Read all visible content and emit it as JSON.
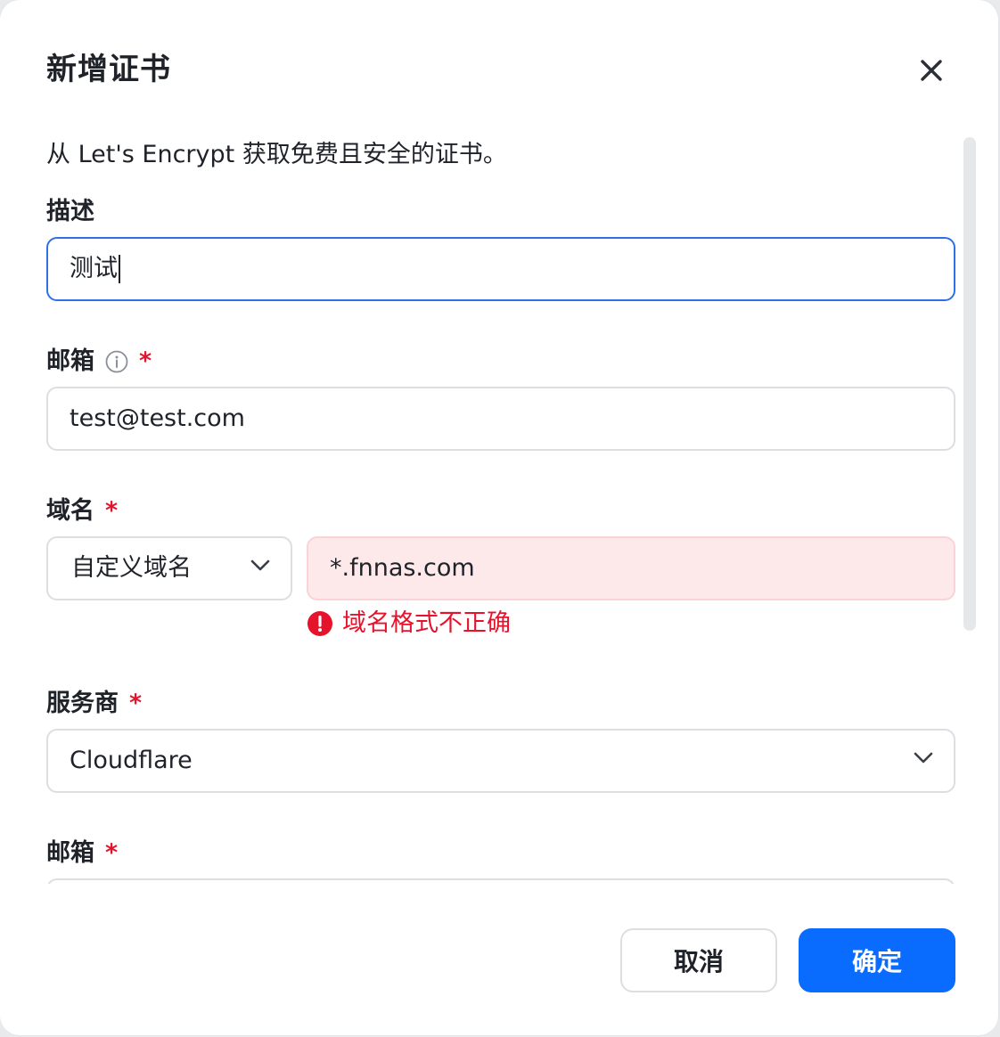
{
  "dialog": {
    "title": "新增证书",
    "intro": "从 Let's Encrypt 获取免费且安全的证书。"
  },
  "fields": {
    "description": {
      "label": "描述",
      "value": "测试"
    },
    "email": {
      "label": "邮箱",
      "required_mark": "*",
      "value": "test@test.com"
    },
    "domain": {
      "label": "域名",
      "required_mark": "*",
      "type_selected": "自定义域名",
      "value": "*.fnnas.com",
      "error": "域名格式不正确"
    },
    "provider": {
      "label": "服务商",
      "required_mark": "*",
      "selected": "Cloudflare"
    },
    "provider_email": {
      "label": "邮箱",
      "required_mark": "*"
    }
  },
  "buttons": {
    "cancel": "取消",
    "ok": "确定"
  },
  "colors": {
    "primary": "#0a6cff",
    "error": "#e5132c",
    "focus_border": "#2f6fe8"
  }
}
